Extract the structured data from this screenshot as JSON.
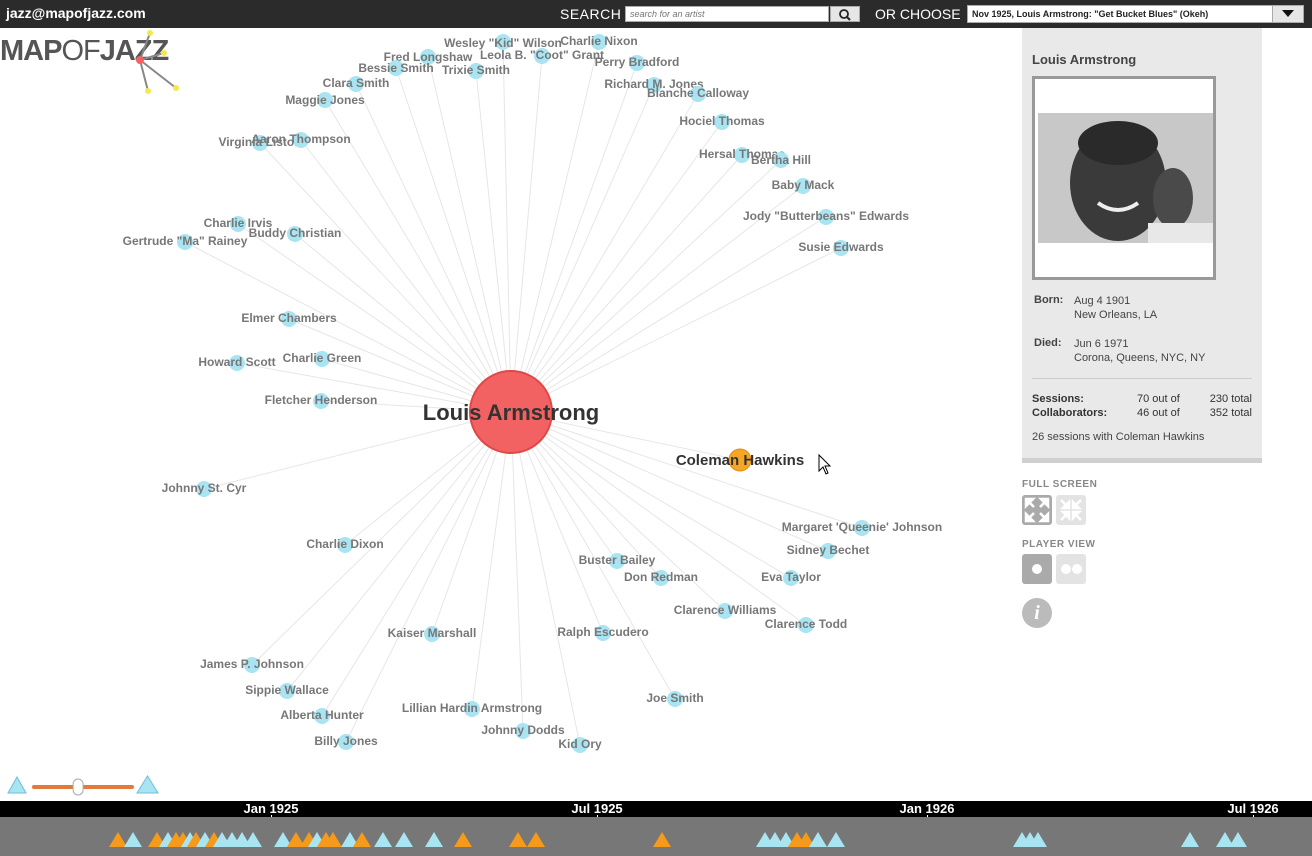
{
  "header": {
    "email": "jazz@mapofjazz.com",
    "search_label": "SEARCH",
    "search_placeholder": "search for an artist",
    "choose_label": "OR CHOOSE",
    "selected_session": "Nov 1925, Louis Armstrong: \"Get Bucket Blues\" (Okeh)"
  },
  "logo": {
    "text_a": "MAP",
    "text_b": "OF",
    "text_c": "JAZZ"
  },
  "graph": {
    "center": {
      "label": "Louis Armstrong",
      "color": "#f26262"
    },
    "highlight": {
      "label": "Coleman Hawkins",
      "color": "#f5a623"
    },
    "node_color": "#a9e4f2",
    "collaborators": [
      "Wesley \"Kid\" Wilson",
      "Charlie Nixon",
      "Fred Longshaw",
      "Leola B. \"Coot\" Grant",
      "Perry Bradford",
      "Bessie Smith",
      "Trixie Smith",
      "Clara Smith",
      "Richard M. Jones",
      "Blanche Calloway",
      "Maggie Jones",
      "Hociel Thomas",
      "Virginia Liston",
      "Aaron Thompson",
      "Hersal Thomas",
      "Bertha Hill",
      "Baby Mack",
      "Jody \"Butterbeans\" Edwards",
      "Charlie Irvis",
      "Buddy Christian",
      "Gertrude \"Ma\" Rainey",
      "Susie Edwards",
      "Elmer Chambers",
      "Howard Scott",
      "Charlie Green",
      "Fletcher Henderson",
      "Johnny St. Cyr",
      "Margaret 'Queenie' Johnson",
      "Sidney Bechet",
      "Charlie Dixon",
      "Buster Bailey",
      "Don Redman",
      "Eva Taylor",
      "Clarence Williams",
      "Clarence Todd",
      "Kaiser Marshall",
      "Ralph Escudero",
      "James P. Johnson",
      "Sippie Wallace",
      "Joe Smith",
      "Alberta Hunter",
      "Lillian Hardin Armstrong",
      "Johnny Dodds",
      "Billy Jones",
      "Kid Ory"
    ]
  },
  "panel": {
    "artist_name": "Louis Armstrong",
    "born_label": "Born:",
    "born_date": "Aug 4 1901",
    "born_place": "New Orleans, LA",
    "died_label": "Died:",
    "died_date": "Jun 6 1971",
    "died_place": "Corona, Queens, NYC, NY",
    "sessions_label": "Sessions:",
    "sessions_count": "70 out of",
    "sessions_total": "230 total",
    "collab_label": "Collaborators:",
    "collab_count": "46 out of",
    "collab_total": "352 total",
    "note": "26 sessions with Coleman Hawkins"
  },
  "controls": {
    "fullscreen_label": "FULL SCREEN",
    "player_view_label": "PLAYER VIEW",
    "info_glyph": "i"
  },
  "timeline": {
    "ticks": [
      "Jan 1925",
      "Jul 1925",
      "Jan 1926",
      "Jul 1926"
    ],
    "slider_value": 0.45,
    "colors": {
      "orange": "#f59a1a",
      "blue": "#a9e4f2"
    }
  }
}
